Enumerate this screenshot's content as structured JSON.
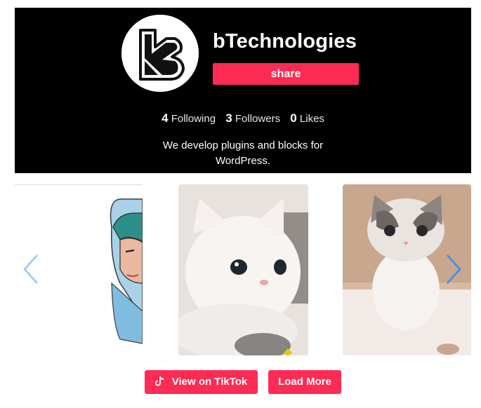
{
  "profile": {
    "name": "bTechnologies",
    "share_label": "share",
    "stats": {
      "following_count": "4",
      "following_label": "Following",
      "followers_count": "3",
      "followers_label": "Followers",
      "likes_count": "0",
      "likes_label": "Likes"
    },
    "bio": "We develop plugins and blocks for WordPress."
  },
  "carousel": {
    "items": [
      {
        "thumbnail": "hijab-illustration"
      },
      {
        "thumbnail": "white-kitten"
      },
      {
        "thumbnail": "tabby-kitten"
      }
    ]
  },
  "actions": {
    "view_label": "View on TikTok",
    "load_more_label": "Load More"
  },
  "colors": {
    "accent": "#fe2c55",
    "header_bg": "#000000",
    "arrow": "#3b8ee8"
  },
  "icons": {
    "prev": "chevron-left-icon",
    "next": "chevron-right-icon",
    "tiktok": "tiktok-icon",
    "heart": "heart-icon"
  }
}
